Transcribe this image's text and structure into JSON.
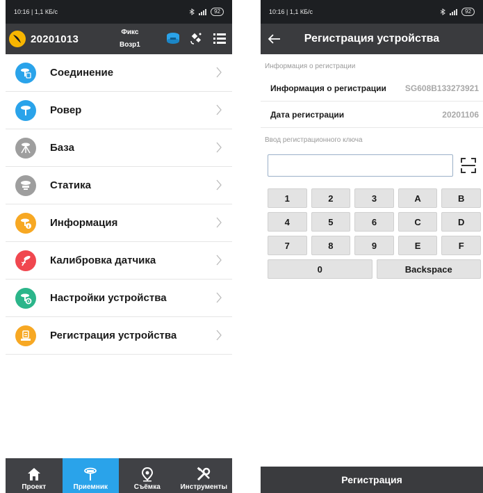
{
  "left": {
    "status": {
      "time": "10:16 | 1,1 КБ/с",
      "battery": "92"
    },
    "topbar": {
      "project": "20201013",
      "fix": "Фикс",
      "mode": "Возр1"
    },
    "menu": [
      {
        "label": "Соединение",
        "icon": "receiver-link-icon",
        "color": "#2aa3ea"
      },
      {
        "label": "Ровер",
        "icon": "rover-antenna-icon",
        "color": "#2aa3ea"
      },
      {
        "label": "База",
        "icon": "base-tripod-icon",
        "color": "#9e9e9e"
      },
      {
        "label": "Статика",
        "icon": "static-receiver-icon",
        "color": "#9e9e9e"
      },
      {
        "label": "Информация",
        "icon": "info-receiver-icon",
        "color": "#f7a823"
      },
      {
        "label": "Калибровка датчика",
        "icon": "sensor-calibration-icon",
        "color": "#f0474f"
      },
      {
        "label": "Настройки устройства",
        "icon": "device-settings-icon",
        "color": "#2bb58a"
      },
      {
        "label": "Регистрация устройства",
        "icon": "device-registration-icon",
        "color": "#f7a823"
      }
    ],
    "nav": [
      {
        "label": "Проект",
        "icon": "home-icon"
      },
      {
        "label": "Приемник",
        "icon": "receiver-icon"
      },
      {
        "label": "Съёмка",
        "icon": "location-pin-icon"
      },
      {
        "label": "Инструменты",
        "icon": "tools-icon"
      }
    ],
    "colors": {
      "accent": "#2aa3ea",
      "bar": "#3a3b3e"
    }
  },
  "right": {
    "status": {
      "time": "10:16 | 1,1 КБ/с",
      "battery": "92"
    },
    "title": "Регистрация устройства",
    "section_info": "Информация о регистрации",
    "rows": [
      {
        "key": "Информация о регистрации",
        "value": "SG608B133273921"
      },
      {
        "key": "Дата регистрации",
        "value": "20201106"
      }
    ],
    "section_key": "Ввод регистрационного ключа",
    "key_input": {
      "value": "",
      "placeholder": ""
    },
    "keypad": [
      [
        "1",
        "2",
        "3",
        "A",
        "B"
      ],
      [
        "4",
        "5",
        "6",
        "C",
        "D"
      ],
      [
        "7",
        "8",
        "9",
        "E",
        "F"
      ],
      [
        "0",
        "Backspace"
      ]
    ],
    "register_label": "Регистрация"
  }
}
